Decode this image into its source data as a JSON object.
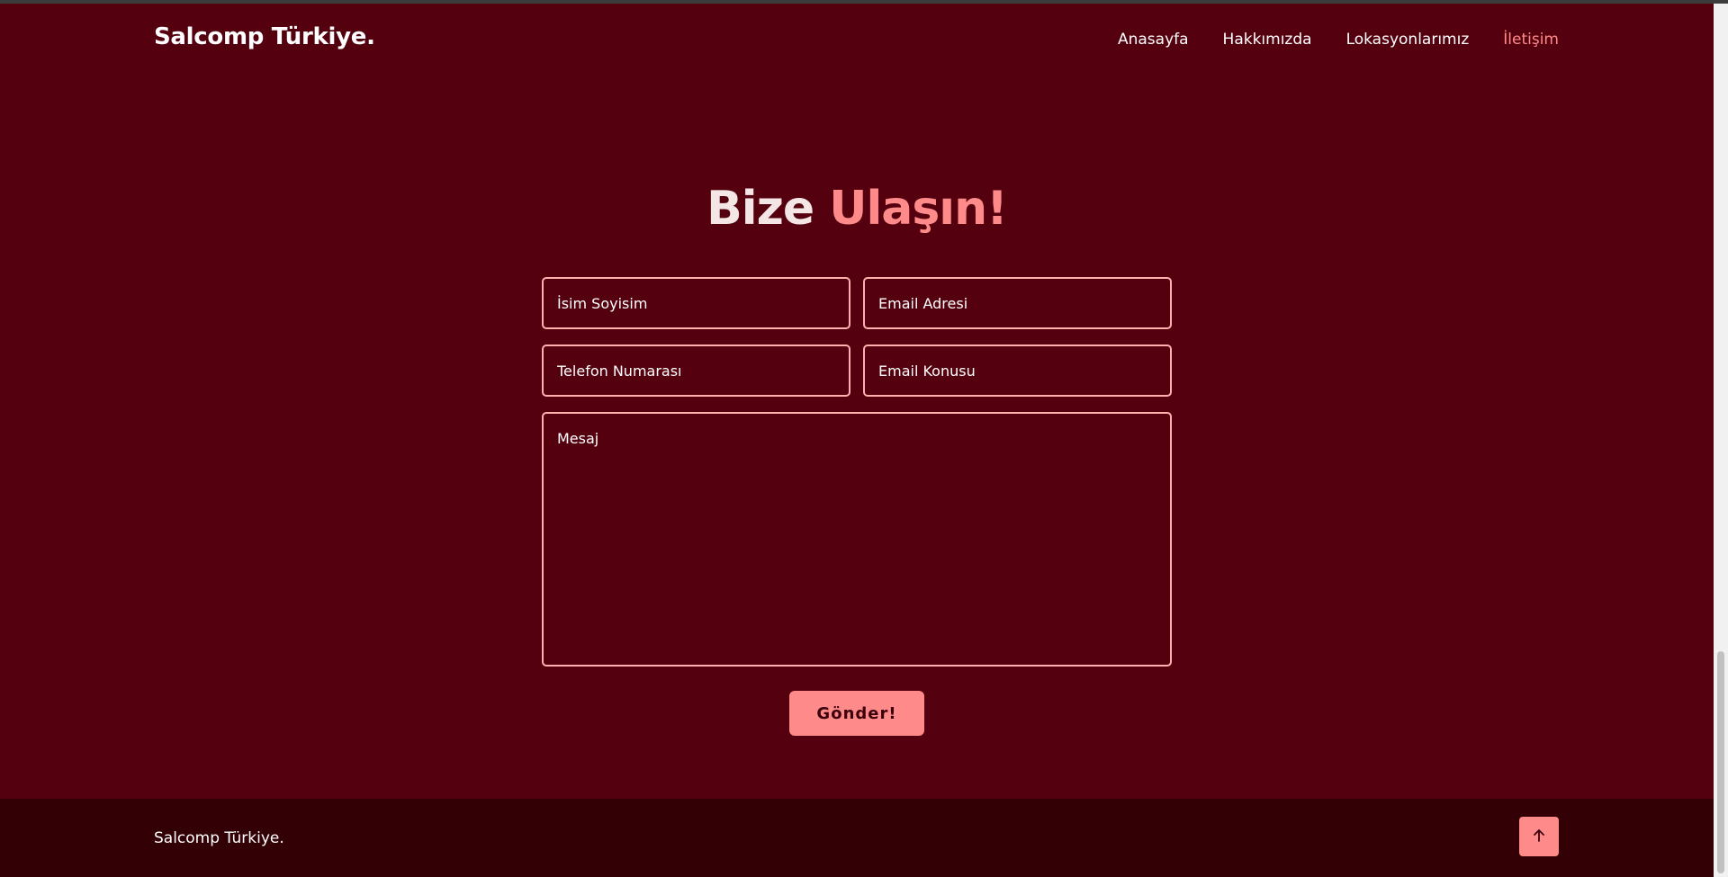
{
  "header": {
    "logo": "Salcomp Türkiye.",
    "nav": [
      {
        "label": "Anasayfa",
        "active": false
      },
      {
        "label": "Hakkımızda",
        "active": false
      },
      {
        "label": "Lokasyonlarımız",
        "active": false
      },
      {
        "label": "İletişim",
        "active": true
      }
    ]
  },
  "contact": {
    "heading_part1": "Bize",
    "heading_part2": "Ulaşın!",
    "fields": {
      "name_placeholder": "İsim Soyisim",
      "email_placeholder": "Email Adresi",
      "phone_placeholder": "Telefon Numarası",
      "subject_placeholder": "Email Konusu",
      "message_placeholder": "Mesaj"
    },
    "submit_label": "Gönder!"
  },
  "footer": {
    "text": "Salcomp Türkiye.",
    "scroll_top_icon": "arrow-up-icon"
  },
  "colors": {
    "background": "#54000f",
    "footer_background": "#320005",
    "accent": "#ff8a8a",
    "field_border": "#ffb0b0",
    "text": "#ffffff"
  }
}
